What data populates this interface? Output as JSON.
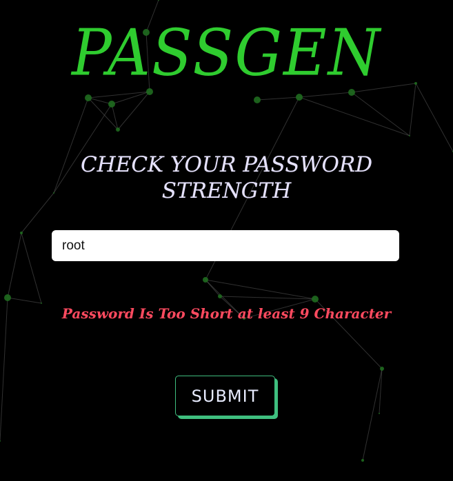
{
  "app": {
    "title": "PASSGEN"
  },
  "main": {
    "heading_line1": "CHECK YOUR PASSWORD",
    "heading_line2": "STRENGTH",
    "password_input": {
      "value": "root",
      "placeholder": ""
    },
    "validation_message": "Password Is Too Short at least 9 Character",
    "submit_label": "SUBMIT"
  },
  "colors": {
    "background": "#000000",
    "brand": "#2fcc2f",
    "heading": "#e6e2ff",
    "error": "#ff4a5f",
    "button_text": "#e8ecff",
    "button_border": "#3fbf7f",
    "button_shadow": "#3fbf7f",
    "network_line": "#5a5a5a",
    "network_node": "#1f6b1f"
  }
}
